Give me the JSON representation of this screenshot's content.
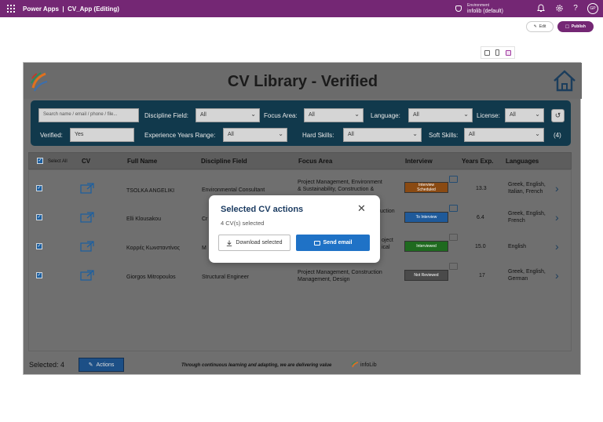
{
  "topbar": {
    "app_name": "Power Apps",
    "separator": "|",
    "doc_title": "CV_App (Editing)",
    "environment_label": "Environment",
    "environment_name": "infolib (default)",
    "avatar_initials": "GP"
  },
  "editor": {
    "edit_label": "Edit",
    "publish_label": "Publish"
  },
  "app": {
    "heading": "CV Library - Verified",
    "filters": {
      "search_placeholder": "Search name / email / phone / file...",
      "discipline_label": "Discipline Field:",
      "discipline_value": "All",
      "focus_label": "Focus Area:",
      "focus_value": "All",
      "language_label": "Language:",
      "language_value": "All",
      "license_label": "License:",
      "license_value": "All",
      "verified_label": "Verified:",
      "verified_value": "Yes",
      "experience_label": "Experience Years Range:",
      "experience_value": "All",
      "hard_skills_label": "Hard Skills:",
      "hard_skills_value": "All",
      "soft_skills_label": "Soft Skills:",
      "soft_skills_value": "All",
      "result_count": "(4)"
    },
    "table": {
      "select_all": "Select All",
      "headers": {
        "cv": "CV",
        "full_name": "Full Name",
        "discipline": "Discipline Field",
        "focus": "Focus Area",
        "interview": "Interview",
        "years": "Years Exp.",
        "languages": "Languages"
      },
      "rows": [
        {
          "name": "TSOLKA ANGELIKI",
          "discipline": "Environmental Consultant",
          "focus_1": "Project Management, Environment",
          "focus_2": "& Sustainability, Construction &",
          "interview_1": "Interview",
          "interview_2": "Scheduled",
          "interview_color": "#8a4a12",
          "years": "13.3",
          "lang_1": "Greek, English,",
          "lang_2": "Italian, French"
        },
        {
          "name": "Elli Klousakou",
          "discipline": "Cr",
          "focus_1": "uction",
          "focus_2": "",
          "interview_1": "To Interview",
          "interview_2": "",
          "interview_color": "#1f5a9a",
          "years": "6.4",
          "lang_1": "Greek, English,",
          "lang_2": "French"
        },
        {
          "name": "Κορρές Κωνσταντίνος",
          "discipline": "M",
          "focus_1": "oject",
          "focus_2": "ical",
          "interview_1": "Interviewed",
          "interview_2": "",
          "interview_color": "#1f6a1f",
          "years": "15.0",
          "lang_1": "English",
          "lang_2": ""
        },
        {
          "name": "Giorgos Mitropoulos",
          "discipline": "Structural Engineer",
          "focus_1": "Project Management, Construction",
          "focus_2": "Management, Design",
          "interview_1": "Not Reviewed",
          "interview_2": "",
          "interview_color": "#4a4a4a",
          "years": "17",
          "lang_1": "Greek, English,",
          "lang_2": "German"
        }
      ]
    },
    "footer": {
      "selected": "Selected: 4",
      "actions_label": "Actions",
      "tagline": "Through continuous learning and adapting, we are delivering value",
      "logo_text": "infoLib"
    }
  },
  "modal": {
    "title": "Selected CV actions",
    "subtitle": "4 CV(s) selected",
    "download_label": "Download selected",
    "email_label": "Send email"
  }
}
